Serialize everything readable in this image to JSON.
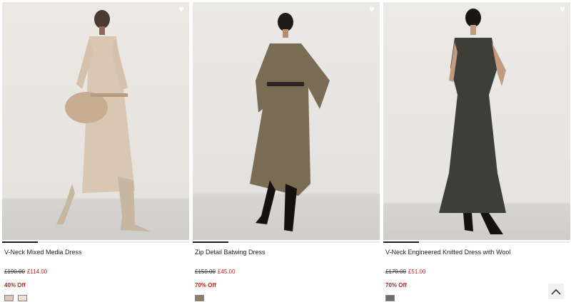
{
  "products": [
    {
      "title": "V-Neck Mixed Media Dress",
      "was": "£190.00",
      "now": "£114.00",
      "discount": "40% Off",
      "swatches": [
        "#d8c8b6",
        "#ece2d6"
      ],
      "photo_icon": "heart-icon"
    },
    {
      "title": "Zip Detail Batwing Dress",
      "was": "£150.00",
      "now": "£45.00",
      "discount": "70% Off",
      "swatches": [
        "#8b7d66"
      ],
      "photo_icon": "heart-icon"
    },
    {
      "title": "V-Neck Engineered Knitted Dress with Wool",
      "was": "£170.00",
      "now": "£51.00",
      "discount": "70% Off",
      "swatches": [
        "#6e6e6e"
      ],
      "photo_icon": "heart-icon"
    }
  ],
  "ui": {
    "wishlist_glyph": "♥",
    "back_to_top_icon": "chevron-up-icon",
    "accent_sale": "#b3261e"
  }
}
